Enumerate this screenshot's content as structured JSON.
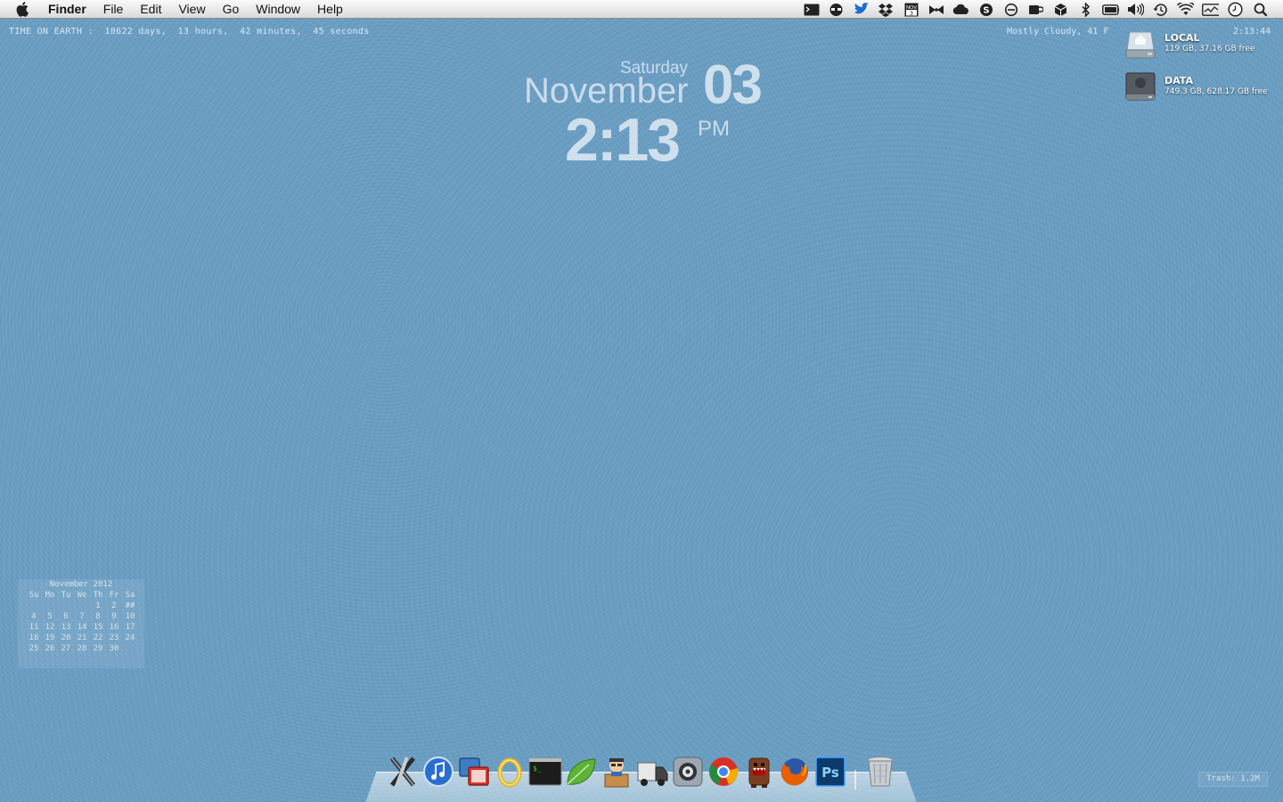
{
  "menubar": {
    "app_name": "Finder",
    "items": [
      "File",
      "Edit",
      "View",
      "Go",
      "Window",
      "Help"
    ],
    "status_icons": [
      "terminal-icon",
      "spy-icon",
      "twitter-bird-icon",
      "dropbox-icon",
      "calendar-date-icon",
      "bowtie-icon",
      "cloud-icon",
      "skype-icon",
      "no-entry-icon",
      "caffeine-cup-icon",
      "box-icon",
      "bluetooth-icon",
      "battery-icon",
      "volume-icon",
      "time-machine-icon",
      "wifi-icon",
      "activity-monitor-icon",
      "clock-icon",
      "spotlight-icon"
    ],
    "calendar_icon_month": "NOV",
    "calendar_icon_day": "3"
  },
  "geektool": {
    "time_on_earth": "TIME ON EARTH :  10622 days,  13 hours,  42 minutes,  45 seconds",
    "weather": "Mostly Cloudy, 41 F",
    "time_seconds": "2:13:44"
  },
  "clock": {
    "weekday": "Saturday",
    "month": "November",
    "day": "03",
    "time": "2:13",
    "ampm": "PM"
  },
  "drives": [
    {
      "name": "LOCAL",
      "info": "119 GB, 37.16 GB free"
    },
    {
      "name": "DATA",
      "info": "749.3 GB, 628.17 GB free"
    }
  ],
  "calendar": {
    "title": "November 2012",
    "headers": [
      "Su",
      "Mo",
      "Tu",
      "We",
      "Th",
      "Fr",
      "Sa"
    ],
    "weeks": [
      [
        "",
        "",
        "",
        "",
        "1",
        "2",
        "##"
      ],
      [
        "4",
        "5",
        "6",
        "7",
        "8",
        "9",
        "10"
      ],
      [
        "11",
        "12",
        "13",
        "14",
        "15",
        "16",
        "17"
      ],
      [
        "18",
        "19",
        "20",
        "21",
        "22",
        "23",
        "24"
      ],
      [
        "25",
        "26",
        "27",
        "28",
        "29",
        "30",
        ""
      ]
    ]
  },
  "dock": {
    "apps": [
      "xcode-icon",
      "itunes-icon",
      "vmware-icon",
      "o-ring-icon",
      "terminal-icon",
      "leaf-icon",
      "transmit-icon",
      "delivery-truck-icon",
      "system-preferences-icon",
      "chrome-icon",
      "domo-kun-icon",
      "firefox-icon",
      "photoshop-icon"
    ],
    "photoshop_label": "Ps",
    "trash": "trash-icon"
  },
  "trash_label": "Trash: 1.2M",
  "colors": {
    "desktop": "#6a9ec4",
    "menubar": "#e6e6e6"
  }
}
